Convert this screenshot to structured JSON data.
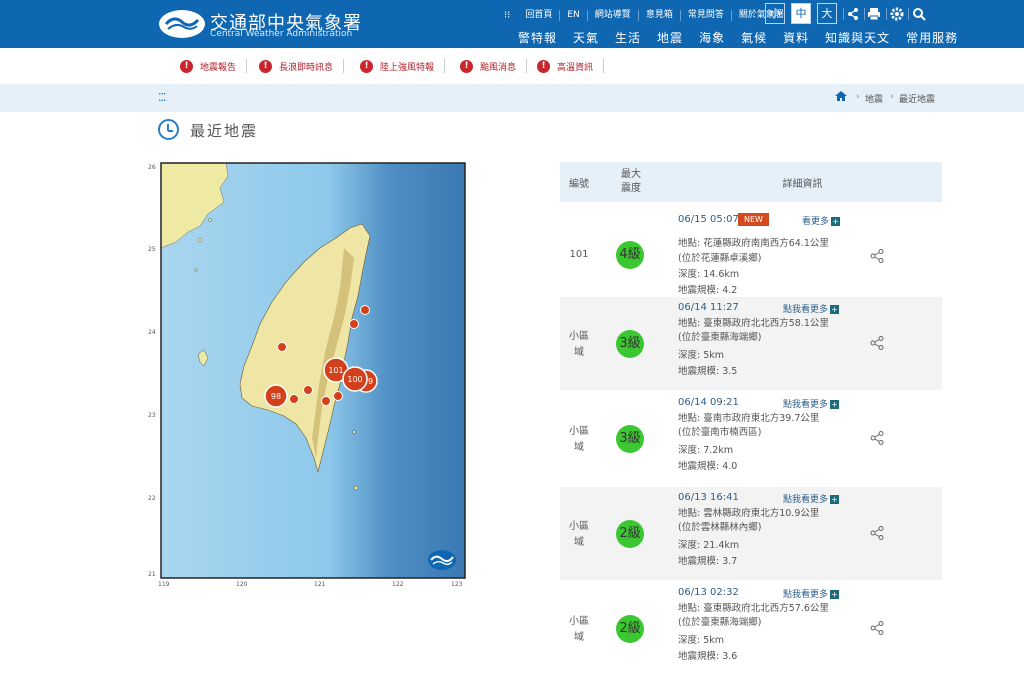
{
  "header": {
    "brand_zh": "交通部中央氣象署",
    "brand_en": "Central Weather Administration",
    "top_links": [
      "回首頁",
      "EN",
      "網站導覽",
      "意見箱",
      "常見問答",
      "關於氣象署"
    ],
    "font_sizes": [
      "小",
      "中",
      "大"
    ],
    "active_font_size": "中",
    "nav": [
      "警特報",
      "天氣",
      "生活",
      "地震",
      "海象",
      "氣候",
      "資料",
      "知識與天文",
      "常用服務"
    ]
  },
  "alerts": [
    "地震報告",
    "長浪即時訊息",
    "陸上強風特報",
    "颱風消息",
    "高溫資訊"
  ],
  "breadcrumb": {
    "items": [
      "地震",
      "最近地震"
    ]
  },
  "page_title": "最近地震",
  "map": {
    "lat_labels": [
      "26",
      "25",
      "24",
      "23",
      "22",
      "21"
    ],
    "lon_labels": [
      "119",
      "120",
      "121",
      "122",
      "123"
    ],
    "markers": [
      {
        "label": "101",
        "kind": "big"
      },
      {
        "label": "100",
        "kind": "big"
      },
      {
        "label": "99",
        "kind": "big"
      },
      {
        "label": "98",
        "kind": "big"
      }
    ]
  },
  "table": {
    "headers": {
      "id": "編號",
      "max_intensity": "最大\n震度",
      "detail": "詳細資訊"
    },
    "rows": [
      {
        "id": "101",
        "intensity": "4級",
        "datetime": "06/15 05:07",
        "new_badge": "NEW",
        "more": "看更多",
        "location": "地點: 花蓮縣政府南南西方64.1公里",
        "location2": "(位於花蓮縣卓溪鄉)",
        "depth": "深度: 14.6km",
        "magnitude": "地震規模: 4.2"
      },
      {
        "id": "小區\n域",
        "intensity": "3級",
        "datetime": "06/14 11:27",
        "more": "點我看更多",
        "location": "地點: 臺東縣政府北北西方58.1公里",
        "location2": "(位於臺東縣海端鄉)",
        "depth": "深度: 5km",
        "magnitude": "地震規模: 3.5"
      },
      {
        "id": "小區\n域",
        "intensity": "3級",
        "datetime": "06/14 09:21",
        "more": "點我看更多",
        "location": "地點: 臺南市政府東北方39.7公里",
        "location2": "(位於臺南市楠西區)",
        "depth": "深度: 7.2km",
        "magnitude": "地震規模: 4.0"
      },
      {
        "id": "小區\n域",
        "intensity": "2級",
        "datetime": "06/13 16:41",
        "more": "點我看更多",
        "location": "地點: 雲林縣政府東北方10.9公里",
        "location2": "(位於雲林縣林內鄉)",
        "depth": "深度: 21.4km",
        "magnitude": "地震規模: 3.7"
      },
      {
        "id": "小區\n域",
        "intensity": "2級",
        "datetime": "06/13 02:32",
        "more": "點我看更多",
        "location": "地點: 臺東縣政府北北西方57.6公里",
        "location2": "(位於臺東縣海端鄉)",
        "depth": "深度: 5km",
        "magnitude": "地震規模: 3.6"
      }
    ]
  },
  "colors": {
    "brand_blue": "#0f67b1",
    "alert_red": "#c9252d",
    "intensity_green": "#3ac72f",
    "marker_red": "#d2411c"
  }
}
